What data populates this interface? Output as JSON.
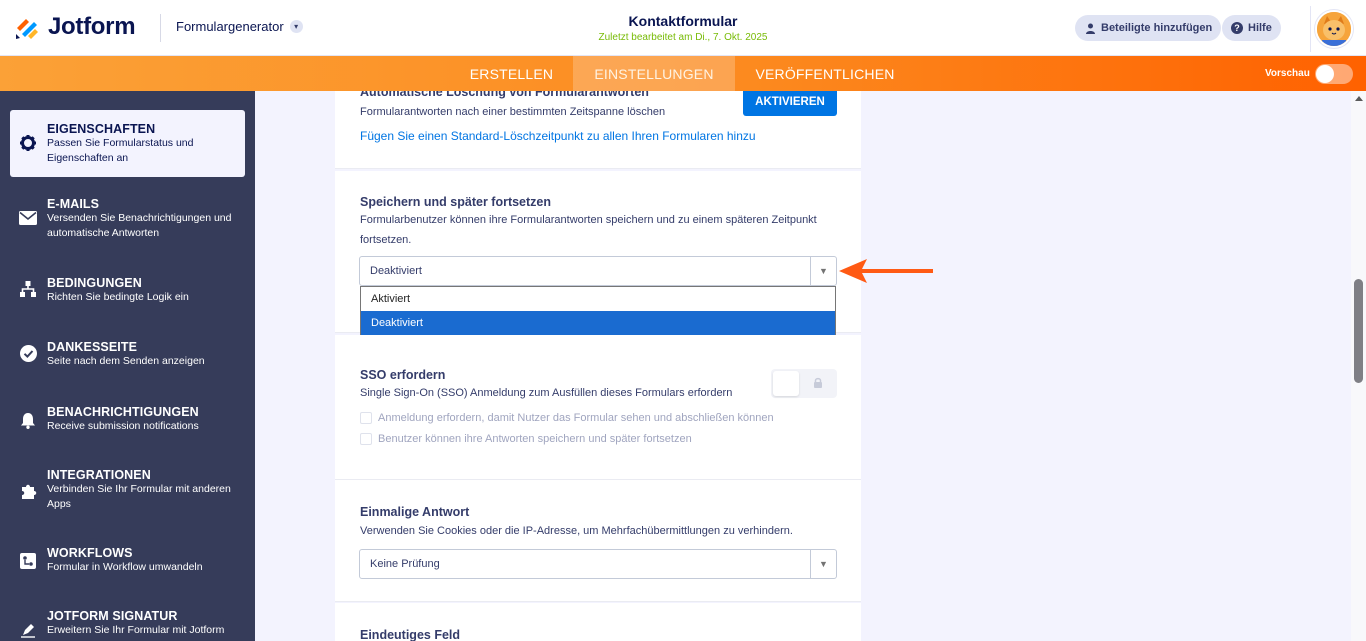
{
  "header": {
    "brand": "Jotform",
    "form_generator": "Formulargenerator",
    "form_title": "Kontaktformular",
    "last_edited": "Zuletzt bearbeitet am Di., 7. Okt. 2025",
    "add_participants": "Beteiligte hinzufügen",
    "help": "Hilfe"
  },
  "nav": {
    "tabs": [
      "ERSTELLEN",
      "EINSTELLUNGEN",
      "VERÖFFENTLICHEN"
    ],
    "active_tab": "EINSTELLUNGEN",
    "preview_label": "Vorschau",
    "preview_on": false
  },
  "sidebar": {
    "items": [
      {
        "title": "EIGENSCHAFTEN",
        "desc": "Passen Sie Formularstatus und Eigenschaften an",
        "icon": "gear-icon",
        "active": true
      },
      {
        "title": "E-MAILS",
        "desc": "Versenden Sie Benachrichtigungen und automatische Antworten",
        "icon": "envelope-icon"
      },
      {
        "title": "BEDINGUNGEN",
        "desc": "Richten Sie bedingte Logik ein",
        "icon": "sitemap-icon"
      },
      {
        "title": "DANKESSEITE",
        "desc": "Seite nach dem Senden anzeigen",
        "icon": "check-circle-icon"
      },
      {
        "title": "BENACHRICHTIGUNGEN",
        "desc": "Receive submission notifications",
        "icon": "bell-icon"
      },
      {
        "title": "INTEGRATIONEN",
        "desc": "Verbinden Sie Ihr Formular mit anderen Apps",
        "icon": "puzzle-icon"
      },
      {
        "title": "WORKFLOWS",
        "desc": "Formular in Workflow umwandeln",
        "icon": "workflow-icon"
      },
      {
        "title": "JOTFORM SIGNATUR",
        "desc": "Erweitern Sie Ihr Formular mit Jotform",
        "icon": "pen-icon"
      }
    ]
  },
  "main": {
    "auto_delete": {
      "title": "Automatische Löschung von Formularantworten",
      "desc": "Formularantworten nach einer bestimmten Zeitspanne löschen",
      "button": "AKTIVIEREN",
      "link": "Fügen Sie einen Standard-Löschzeitpunkt zu allen Ihren Formularen hinzu"
    },
    "save_continue": {
      "title": "Speichern und später fortsetzen",
      "desc_line1": "Formularbenutzer können ihre Formularantworten speichern und zu einem späteren Zeitpunkt",
      "desc_line2": "fortsetzen.",
      "selected": "Deaktiviert",
      "options": [
        "Aktiviert",
        "Deaktiviert"
      ]
    },
    "sso": {
      "title": "SSO erfordern",
      "desc": "Single Sign-On (SSO) Anmeldung zum Ausfüllen dieses Formulars erfordern",
      "check1": "Anmeldung erfordern, damit Nutzer das Formular sehen und abschließen können",
      "check2": "Benutzer können ihre Antworten speichern und später fortsetzen",
      "enabled": false
    },
    "single_response": {
      "title": "Einmalige Antwort",
      "desc": "Verwenden Sie Cookies oder die IP-Adresse, um Mehrfachübermittlungen zu verhindern.",
      "selected": "Keine Prüfung"
    },
    "unique_field": {
      "title": "Eindeutiges Feld"
    }
  },
  "colors": {
    "accent_orange": "#ff6100",
    "primary_blue": "#0075e3",
    "sidebar_bg": "#363c5a"
  }
}
